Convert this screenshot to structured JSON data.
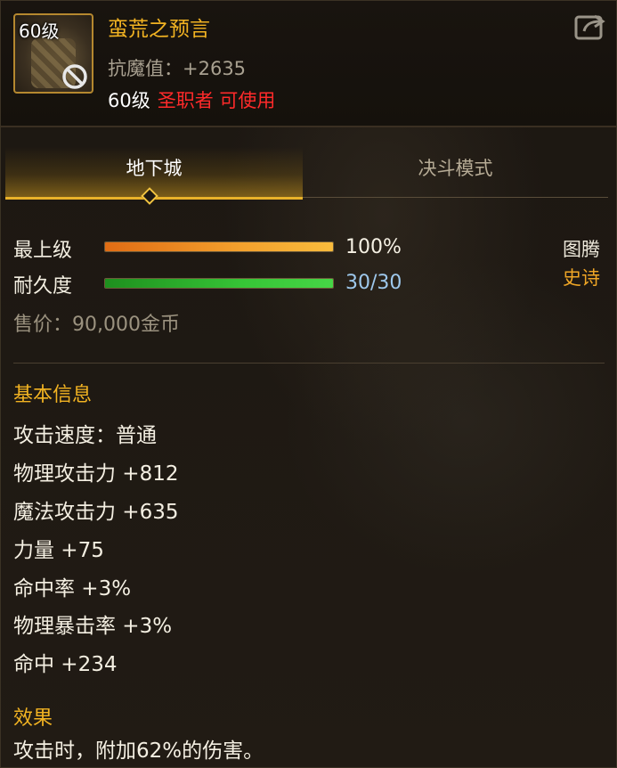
{
  "item": {
    "level_badge": "60级",
    "name": "蛮荒之预言",
    "resist": "抗魔值：+2635",
    "required_level": "60级",
    "usable_by": "圣职者 可使用"
  },
  "tabs": [
    {
      "label": "地下城",
      "active": true
    },
    {
      "label": "决斗模式",
      "active": false
    }
  ],
  "stats": {
    "upgrade_label": "最上级",
    "upgrade_value": "100%",
    "upgrade_fraction": 1.0,
    "durability_label": "耐久度",
    "durability_value": "30/30",
    "durability_fraction": 1.0
  },
  "type": {
    "category": "图腾",
    "rarity": "史诗"
  },
  "price": "售价：90,000金币",
  "basic_info": {
    "title": "基本信息",
    "attributes": [
      "攻击速度：普通",
      "物理攻击力 +812",
      "魔法攻击力 +635",
      "力量 +75",
      "命中率 +3%",
      "物理暴击率 +3%",
      "命中 +234"
    ]
  },
  "effect": {
    "title": "效果",
    "text": "攻击时，附加62%的伤害。"
  },
  "colors": {
    "gold": "#f2b322",
    "red": "#ff2a2a",
    "epic": "#f0a626",
    "durability_blue": "#9ec8ec"
  },
  "icons": {
    "item": "totem-item-icon",
    "unusable": "ban-icon",
    "share": "share-icon",
    "tab_marker": "diamond-icon"
  }
}
